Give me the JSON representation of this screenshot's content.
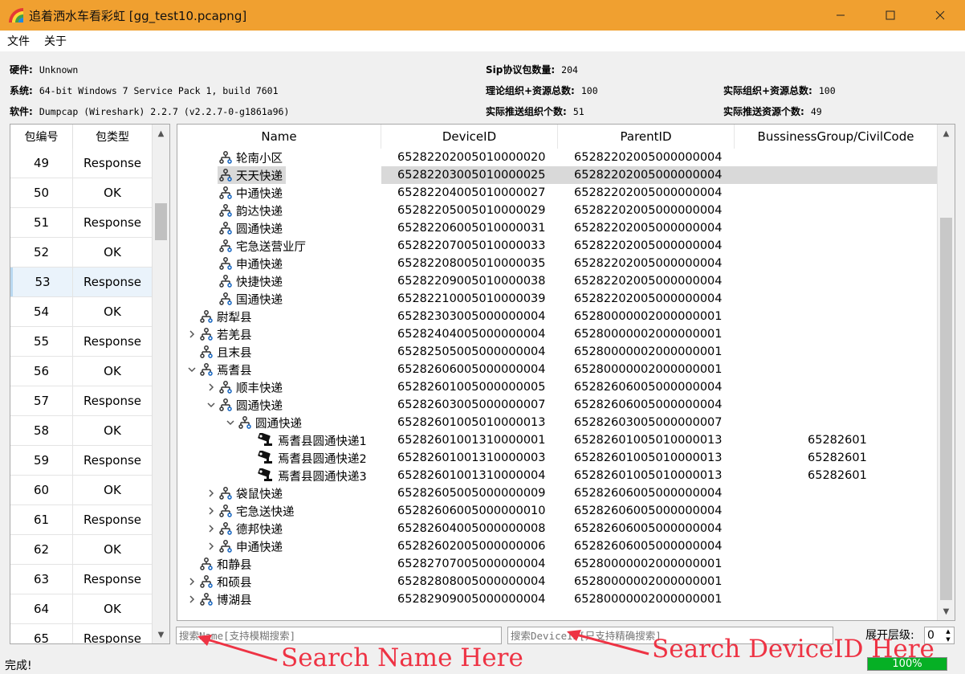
{
  "window": {
    "title": "追着洒水车看彩虹 [gg_test10.pcapng]"
  },
  "menu": [
    "文件",
    "关于"
  ],
  "info": {
    "hardware_label": "硬件:",
    "hardware": "Unknown",
    "system_label": "系统:",
    "system": "64-bit Windows 7 Service Pack 1, build 7601",
    "software_label": "软件:",
    "software": "Dumpcap (Wireshark) 2.2.7 (v2.2.7-0-g1861a96)",
    "sip_count_label": "Sip协议包数量:",
    "sip_count": "204",
    "theory_total_label": "理论组织+资源总数:",
    "theory_total": "100",
    "actual_total_label": "实际组织+资源总数:",
    "actual_total": "100",
    "pushed_org_label": "实际推送组织个数:",
    "pushed_org": "51",
    "pushed_res_label": "实际推送资源个数:",
    "pushed_res": "49"
  },
  "packets": {
    "headers": [
      "包编号",
      "包类型"
    ],
    "rows": [
      [
        "49",
        "Response"
      ],
      [
        "50",
        "OK"
      ],
      [
        "51",
        "Response"
      ],
      [
        "52",
        "OK"
      ],
      [
        "53",
        "Response"
      ],
      [
        "54",
        "OK"
      ],
      [
        "55",
        "Response"
      ],
      [
        "56",
        "OK"
      ],
      [
        "57",
        "Response"
      ],
      [
        "58",
        "OK"
      ],
      [
        "59",
        "Response"
      ],
      [
        "60",
        "OK"
      ],
      [
        "61",
        "Response"
      ],
      [
        "62",
        "OK"
      ],
      [
        "63",
        "Response"
      ],
      [
        "64",
        "OK"
      ],
      [
        "65",
        "Response"
      ]
    ],
    "selected_index": 4
  },
  "tree": {
    "headers": [
      "Name",
      "DeviceID",
      "ParentID",
      "BussinessGroup/CivilCode"
    ],
    "rows": [
      {
        "level": 2,
        "arrow": "",
        "icon": "org",
        "name": "轮南小区",
        "device": "65282202005010000020",
        "parent": "65282202005000000004",
        "bg": ""
      },
      {
        "level": 2,
        "arrow": "",
        "icon": "org",
        "name": "天天快递",
        "device": "65282203005010000025",
        "parent": "65282202005000000004",
        "bg": "",
        "selected": true
      },
      {
        "level": 2,
        "arrow": "",
        "icon": "org",
        "name": "中通快递",
        "device": "65282204005010000027",
        "parent": "65282202005000000004",
        "bg": ""
      },
      {
        "level": 2,
        "arrow": "",
        "icon": "org",
        "name": "韵达快递",
        "device": "65282205005010000029",
        "parent": "65282202005000000004",
        "bg": ""
      },
      {
        "level": 2,
        "arrow": "",
        "icon": "org",
        "name": "圆通快递",
        "device": "65282206005010000031",
        "parent": "65282202005000000004",
        "bg": ""
      },
      {
        "level": 2,
        "arrow": "",
        "icon": "org",
        "name": "宅急送营业厅",
        "device": "65282207005010000033",
        "parent": "65282202005000000004",
        "bg": ""
      },
      {
        "level": 2,
        "arrow": "",
        "icon": "org",
        "name": "申通快递",
        "device": "65282208005010000035",
        "parent": "65282202005000000004",
        "bg": ""
      },
      {
        "level": 2,
        "arrow": "",
        "icon": "org",
        "name": "快捷快递",
        "device": "65282209005010000038",
        "parent": "65282202005000000004",
        "bg": ""
      },
      {
        "level": 2,
        "arrow": "",
        "icon": "org",
        "name": "国通快递",
        "device": "65282210005010000039",
        "parent": "65282202005000000004",
        "bg": ""
      },
      {
        "level": 1,
        "arrow": "",
        "icon": "org",
        "name": "尉犁县",
        "device": "65282303005000000004",
        "parent": "65280000002000000001",
        "bg": ""
      },
      {
        "level": 1,
        "arrow": "right",
        "icon": "org",
        "name": "若羌县",
        "device": "65282404005000000004",
        "parent": "65280000002000000001",
        "bg": ""
      },
      {
        "level": 1,
        "arrow": "",
        "icon": "org",
        "name": "且末县",
        "device": "65282505005000000004",
        "parent": "65280000002000000001",
        "bg": ""
      },
      {
        "level": 1,
        "arrow": "down",
        "icon": "org",
        "name": "焉耆县",
        "device": "65282606005000000004",
        "parent": "65280000002000000001",
        "bg": ""
      },
      {
        "level": 2,
        "arrow": "right",
        "icon": "org",
        "name": "顺丰快递",
        "device": "65282601005000000005",
        "parent": "65282606005000000004",
        "bg": ""
      },
      {
        "level": 2,
        "arrow": "down",
        "icon": "org",
        "name": "圆通快递",
        "device": "65282603005000000007",
        "parent": "65282606005000000004",
        "bg": ""
      },
      {
        "level": 3,
        "arrow": "down",
        "icon": "org",
        "name": "圆通快递",
        "device": "65282601005010000013",
        "parent": "65282603005000000007",
        "bg": ""
      },
      {
        "level": 4,
        "arrow": "",
        "icon": "camera",
        "name": "焉耆县圆通快递1",
        "device": "65282601001310000001",
        "parent": "65282601005010000013",
        "bg": "65282601"
      },
      {
        "level": 4,
        "arrow": "",
        "icon": "camera",
        "name": "焉耆县圆通快递2",
        "device": "65282601001310000003",
        "parent": "65282601005010000013",
        "bg": "65282601"
      },
      {
        "level": 4,
        "arrow": "",
        "icon": "camera",
        "name": "焉耆县圆通快递3",
        "device": "65282601001310000004",
        "parent": "65282601005010000013",
        "bg": "65282601"
      },
      {
        "level": 2,
        "arrow": "right",
        "icon": "org",
        "name": "袋鼠快递",
        "device": "65282605005000000009",
        "parent": "65282606005000000004",
        "bg": ""
      },
      {
        "level": 2,
        "arrow": "right",
        "icon": "org",
        "name": "宅急送快递",
        "device": "65282606005000000010",
        "parent": "65282606005000000004",
        "bg": ""
      },
      {
        "level": 2,
        "arrow": "right",
        "icon": "org",
        "name": "德邦快递",
        "device": "65282604005000000008",
        "parent": "65282606005000000004",
        "bg": ""
      },
      {
        "level": 2,
        "arrow": "right",
        "icon": "org",
        "name": "申通快递",
        "device": "65282602005000000006",
        "parent": "65282606005000000004",
        "bg": ""
      },
      {
        "level": 1,
        "arrow": "",
        "icon": "org",
        "name": "和静县",
        "device": "65282707005000000004",
        "parent": "65280000002000000001",
        "bg": ""
      },
      {
        "level": 1,
        "arrow": "right",
        "icon": "org",
        "name": "和硕县",
        "device": "65282808005000000004",
        "parent": "65280000002000000001",
        "bg": ""
      },
      {
        "level": 1,
        "arrow": "right",
        "icon": "org",
        "name": "博湖县",
        "device": "65282909005000000004",
        "parent": "65280000002000000001",
        "bg": ""
      }
    ]
  },
  "search": {
    "name_placeholder": "搜索Name[支持模糊搜索]",
    "device_placeholder": "搜索DeviceID[只支持精确搜索]",
    "level_label": "展开层级:",
    "level_value": "0"
  },
  "annotations": {
    "name": "Search Name Here",
    "device": "Search DeviceID Here"
  },
  "status": {
    "text": "完成!",
    "progress": "100%"
  }
}
